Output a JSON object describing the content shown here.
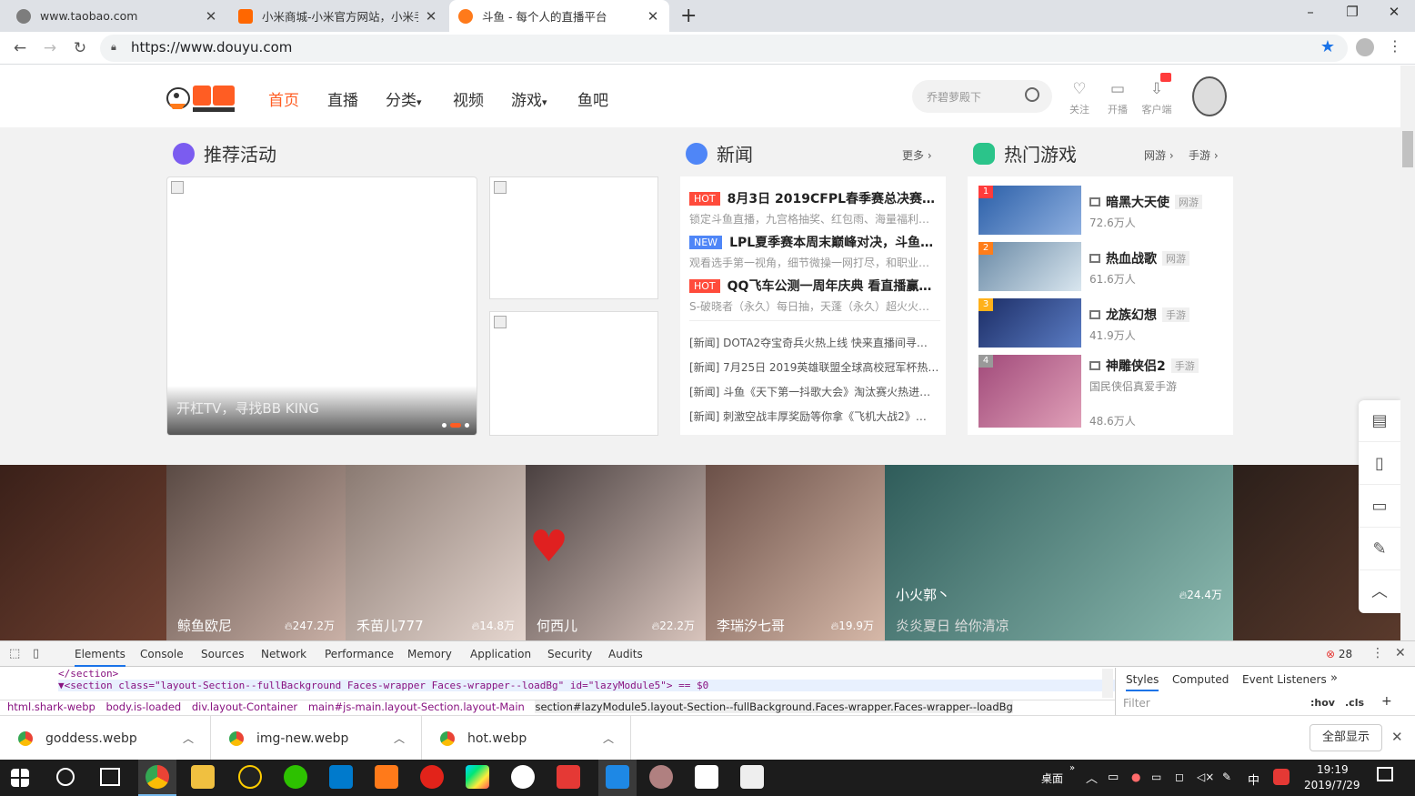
{
  "browser": {
    "tabs": [
      {
        "title": "www.taobao.com",
        "favicon_color": "#7d7d7d",
        "active": false
      },
      {
        "title": "小米商城-小米官方网站，小米手",
        "favicon_color": "#ff6700",
        "active": false
      },
      {
        "title": "斗鱼 - 每个人的直播平台",
        "favicon_color": "#ff7a1a",
        "active": true
      }
    ],
    "new_tab": "+",
    "window_controls": [
      "–",
      "❐",
      "✕"
    ],
    "url": "https://www.douyu.com"
  },
  "site": {
    "nav": [
      {
        "label": "首页",
        "current": true
      },
      {
        "label": "直播",
        "current": false
      },
      {
        "label": "分类",
        "dropdown": "▾"
      },
      {
        "label": "视频",
        "current": false
      },
      {
        "label": "游戏",
        "dropdown": "▾"
      },
      {
        "label": "鱼吧",
        "current": false
      }
    ],
    "search_placeholder": "乔碧萝殿下",
    "header_icons": [
      {
        "label": "关注",
        "icon": "heart-icon",
        "glyph": "♡"
      },
      {
        "label": "开播",
        "icon": "camera-icon",
        "glyph": "▭"
      },
      {
        "label": "客户端",
        "icon": "download-client-icon",
        "glyph": "⇩"
      }
    ],
    "recommend": {
      "title": "推荐活动",
      "slide_caption": "开杠TV，寻找BB KING"
    },
    "news": {
      "title": "新闻",
      "more": "更多 ›",
      "headlines": [
        {
          "tag": "HOT",
          "title": "8月3日 2019CFPL春季赛总决赛…",
          "sub": "锁定斗鱼直播，九宫格抽奖、红包雨、海量福利…"
        },
        {
          "tag": "NEW",
          "title": "LPL夏季赛本周末巅峰对决，斗鱼…",
          "sub": "观看选手第一视角，细节微操一网打尽，和职业…"
        },
        {
          "tag": "HOT",
          "title": "QQ飞车公测一周年庆典 看直播赢…",
          "sub": "S-破晓者（永久）每日抽，天蓬（永久）超火火…"
        }
      ],
      "list": [
        "[新闻] DOTA2夺宝奇兵火热上线 快来直播间寻…",
        "[新闻] 7月25日 2019英雄联盟全球高校冠军杯热…",
        "[新闻] 斗鱼《天下第一抖歌大会》淘汰赛火热进…",
        "[新闻] 刺激空战丰厚奖励等你拿《飞机大战2》…"
      ]
    },
    "hot_games": {
      "title": "热门游戏",
      "links": [
        "网游 ›",
        "手游 ›"
      ],
      "items": [
        {
          "rank": "1",
          "name": "暗黑大天使",
          "type": "网游",
          "desc": "",
          "viewers": "72.6万人",
          "rank_color": "#ff3b3b",
          "thumb": [
            "#2b5fa8",
            "#8fb0e0"
          ]
        },
        {
          "rank": "2",
          "name": "热血战歌",
          "type": "网游",
          "desc": "",
          "viewers": "61.6万人",
          "rank_color": "#ff7d1a",
          "thumb": [
            "#6a8aa6",
            "#d9e6ef"
          ]
        },
        {
          "rank": "3",
          "name": "龙族幻想",
          "type": "手游",
          "desc": "",
          "viewers": "41.9万人",
          "rank_color": "#ffb11a",
          "thumb": [
            "#1c2d66",
            "#5b7dc4"
          ]
        },
        {
          "rank": "4",
          "name": "神雕侠侣2",
          "type": "手游",
          "desc": "国民侠侣真爱手游",
          "viewers": "48.6万人",
          "rank_color": "#999999",
          "thumb": [
            "#a14a7a",
            "#e0a0b8"
          ]
        }
      ]
    },
    "faces": [
      {
        "name": "",
        "hot": "",
        "colors": [
          "#3a2019",
          "#6e4030"
        ]
      },
      {
        "name": "鲸鱼欧尼",
        "hot": "247.2万",
        "colors": [
          "#5a4a44",
          "#c9b0a6"
        ]
      },
      {
        "name": "禾苗儿777",
        "hot": "14.8万",
        "colors": [
          "#8a7a72",
          "#e5d6cf"
        ]
      },
      {
        "name": "何西儿",
        "hot": "22.2万",
        "colors": [
          "#4a4040",
          "#d8c4bc"
        ]
      },
      {
        "name": "李瑞汐七哥",
        "hot": "19.9万",
        "colors": [
          "#6b5048",
          "#d6b8a8"
        ]
      },
      {
        "name": "小火郭丶",
        "hot": "24.4万",
        "sub": "炎炎夏日 给你清凉",
        "colors": [
          "#2f5c5a",
          "#8cbab0"
        ]
      },
      {
        "name": "",
        "hot": "",
        "colors": [
          "#2b1f1a",
          "#5a3a2c"
        ]
      }
    ],
    "side_tools": [
      "▤",
      "▯",
      "▭",
      "✎",
      "︿"
    ]
  },
  "devtools": {
    "tabs": [
      "Elements",
      "Console",
      "Sources",
      "Network",
      "Performance",
      "Memory",
      "Application",
      "Security",
      "Audits"
    ],
    "error_count": "28",
    "code_lines": [
      "</section>",
      "▼<section class=\"layout-Section--fullBackground Faces-wrapper Faces-wrapper--loadBg\" id=\"lazyModule5\"> == $0"
    ],
    "breadcrumbs": [
      "html.shark-webp",
      "body.is-loaded",
      "div.layout-Container",
      "main#js-main.layout-Section.layout-Main",
      "section#lazyModule5.layout-Section--fullBackground.Faces-wrapper.Faces-wrapper--loadBg"
    ],
    "styles_tabs": [
      "Styles",
      "Computed",
      "Event Listeners",
      "»"
    ],
    "filter_placeholder": "Filter",
    "hov": ":hov",
    "cls": ".cls",
    "plus": "+"
  },
  "downloads": {
    "items": [
      "goddess.webp",
      "img-new.webp",
      "hot.webp"
    ],
    "show_all": "全部显示",
    "close": "✕"
  },
  "taskbar": {
    "tray_label": "桌面",
    "ime": "中",
    "time": "19:19",
    "date": "2019/7/29"
  }
}
